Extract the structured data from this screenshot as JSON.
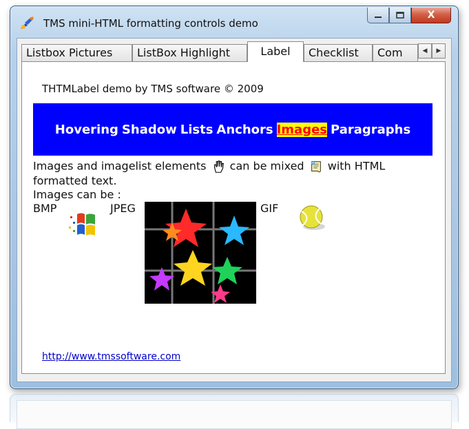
{
  "window": {
    "title": "TMS mini-HTML formatting controls demo",
    "close_label": "X"
  },
  "tabs": [
    {
      "label": "Listbox Pictures",
      "active": false
    },
    {
      "label": "ListBox Highlight",
      "active": false
    },
    {
      "label": "Label",
      "active": true
    },
    {
      "label": "Checklist",
      "active": false
    },
    {
      "label": "Com",
      "active": false
    }
  ],
  "panel": {
    "demo_title": "THTMLabel demo by TMS software © 2009",
    "banner": {
      "background": "#0000ff",
      "highlight_bg": "#ffff00",
      "highlight_fg": "#ff0000",
      "links": [
        "Hovering",
        "Shadow",
        "Lists",
        "Anchors",
        "Images",
        "Paragraphs"
      ],
      "highlighted": "Images"
    },
    "text1_a": "Images and imagelist elements",
    "text1_b": "can be mixed",
    "text1_c": "with HTML",
    "text2": "formatted text.",
    "text3": "Images can be :",
    "bmp_label": "BMP",
    "jpeg_label": "JPEG",
    "gif_label": "GIF",
    "icons": [
      "hand-cursor-icon",
      "script-icon",
      "windows-logo-icon",
      "tennis-ball-icon"
    ],
    "url": "http://www.tmssoftware.com"
  },
  "colors": {
    "accent_blue": "#0000ff",
    "link": "#0000cc"
  }
}
